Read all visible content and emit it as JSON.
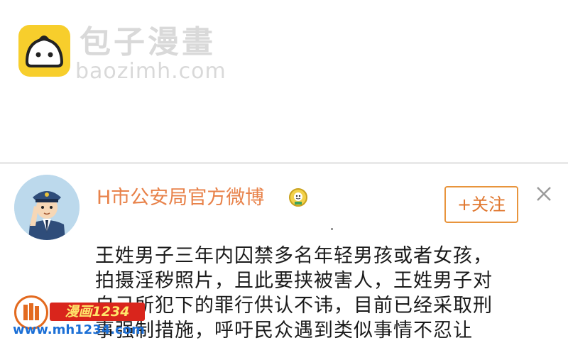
{
  "site": {
    "name": "包子漫畫",
    "url": "baozimh.com"
  },
  "post": {
    "account_name": "H市公安局官方微博",
    "follow_label": "+关注",
    "close_symbol": "✕",
    "text_lines": [
      "王姓男子三年内囚禁多名年轻男孩或者女孩，",
      "拍摄淫秽照片，且此要挟被害人，王姓男子对",
      "自己所犯下的罪行供认不讳，目前已经采取刑",
      "事强制措施，呼吁民众遇到类似事情不忍让"
    ]
  },
  "watermark": {
    "tag": "漫画1234",
    "url": "www.mh1234.com"
  },
  "colors": {
    "brand_yellow": "#f7ce2c",
    "account_orange": "#e8824a",
    "follow_border": "#e8943c",
    "avatar_bg": "#bcd9ec"
  }
}
